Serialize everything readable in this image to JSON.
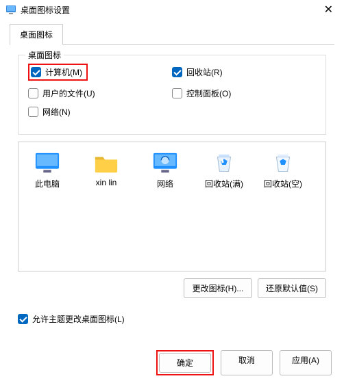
{
  "window": {
    "title": "桌面图标设置"
  },
  "tab": {
    "label": "桌面图标"
  },
  "group": {
    "legend": "桌面图标",
    "checkboxes": {
      "computer": {
        "label": "计算机(M)",
        "checked": true
      },
      "recycle": {
        "label": "回收站(R)",
        "checked": true
      },
      "userfiles": {
        "label": "用户的文件(U)",
        "checked": false
      },
      "ctrlpanel": {
        "label": "控制面板(O)",
        "checked": false
      },
      "network": {
        "label": "网络(N)",
        "checked": false
      }
    }
  },
  "icons": {
    "this_pc": {
      "label": "此电脑"
    },
    "folder": {
      "label": "xin lin"
    },
    "network": {
      "label": "网络"
    },
    "recycle_full": {
      "label": "回收站(满)"
    },
    "recycle_empty": {
      "label": "回收站(空)"
    }
  },
  "buttons": {
    "change_icon": "更改图标(H)...",
    "restore": "还原默认值(S)",
    "ok": "确定",
    "cancel": "取消",
    "apply": "应用(A)"
  },
  "allow_theme": {
    "label": "允许主题更改桌面图标(L)",
    "checked": true
  }
}
